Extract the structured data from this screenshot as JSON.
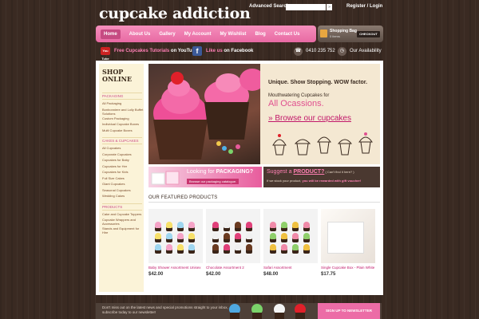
{
  "header": {
    "logo_text": "cupcake addiction",
    "advanced_search_label": "Advanced Search",
    "search_go": "»",
    "register_login": "Register / Login"
  },
  "nav": {
    "items": [
      "Home",
      "About Us",
      "Gallery",
      "My Account",
      "My Wishlist",
      "Blog",
      "Contact Us"
    ]
  },
  "bag": {
    "title": "Shopping Bag",
    "count": "0 items",
    "checkout": "CHECKOUT"
  },
  "social": {
    "youtube_badge": "You Tube",
    "youtube_highlight": "Free Cupcakes Tutorials",
    "youtube_rest": " on YouTube",
    "facebook_highlight": "Like us",
    "facebook_rest": " on Facebook",
    "phone": "0410 235 752",
    "availability": "Our Availability"
  },
  "sidebar": {
    "title": "SHOP ONLINE",
    "sections": [
      {
        "heading": "PACKAGING",
        "items": [
          "All Packaging",
          "Bonbonniere and Lolly Buffet Solutions",
          "Custom Packaging",
          "Individual Cupcake Boxes",
          "Multi Cupcake Boxes"
        ]
      },
      {
        "heading": "CAKES & CUPCAKES",
        "items": [
          "All Cupcakes",
          "Corporate Cupcakes",
          "Cupcakes for Baby",
          "Cupcakes for Her",
          "Cupcakes for Kids",
          "Full Size Cakes",
          "Giant Cupcakes",
          "Seasonal Cupcakes",
          "Wedding Cakes"
        ]
      },
      {
        "heading": "PRODUCTS",
        "items": [
          "Cake and Cupcake Toppers",
          "Cupcake Wrappers and Accessories",
          "Stands and Equipment for Hire"
        ]
      }
    ]
  },
  "hero": {
    "tagline": "Unique. Show Stopping. WOW factor.",
    "sub1": "Mouthwatering Cupcakes for",
    "sub2": "All Ocassions.",
    "browse": "» Browse our cupcakes"
  },
  "banners": {
    "packaging_pre": "Looking for ",
    "packaging_bold": "PACKAGING?",
    "packaging_sub": "Browse our packaging catalogue.",
    "product_pre": "Suggest a ",
    "product_bold": "PRODUCT?",
    "product_small": " ( Can't find it here? )",
    "product_sub": "If we stock your product, ",
    "product_sub_bold": "you will be rewarded with gift voucher!"
  },
  "featured": {
    "heading": "OUR FEATURED PRODUCTS",
    "products": [
      {
        "name": "Baby Shower Assortment Unisex",
        "price": "$42.00",
        "icing": [
          "#f5a3c7",
          "#f7e06a",
          "#9fd6f0"
        ]
      },
      {
        "name": "Chocolate Assortment 2",
        "price": "$42.00",
        "icing": [
          "#e0407a",
          "#f0f0f0",
          "#6a3a20"
        ]
      },
      {
        "name": "Safari Assortment",
        "price": "$48.00",
        "icing": [
          "#f08aa8",
          "#8fcf6a",
          "#f0c040"
        ]
      },
      {
        "name": "Single Cupcake Box - Plain White",
        "price": "$17.75",
        "icing": [
          "#f8f8f8",
          "#f5b8d0",
          "#a8dff0"
        ]
      }
    ]
  },
  "footer": {
    "text": "Don't miss out on the latest news and special promotions straight to your inbox, subscribe today to our newsletter!",
    "newsletter": "SIGN UP TO NEWSLETTER"
  },
  "colors": {
    "accent_pink": "#e86aa3",
    "link_pink": "#c1186a",
    "background": "#3a2a22"
  }
}
